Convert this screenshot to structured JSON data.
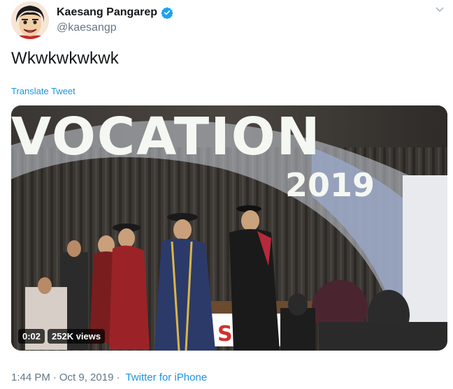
{
  "user": {
    "display_name": "Kaesang Pangarep",
    "handle": "@kaesangp",
    "avatar_icon": "cartoon-face-avatar",
    "verified_icon": "verified-badge-icon"
  },
  "tweet": {
    "text": "Wkwkwkwkwk",
    "translate_label": "Translate Tweet"
  },
  "video": {
    "banner_text": "VOCATION",
    "banner_year": "2019",
    "sign_text": "SUSS",
    "duration": "0:02",
    "views": "252K views"
  },
  "footer": {
    "time": "1:44 PM",
    "separator": "·",
    "date": "Oct 9, 2019",
    "source": "Twitter for iPhone"
  },
  "colors": {
    "link": "#1b95e0",
    "secondary_text": "#657786",
    "verified": "#1da1f2"
  }
}
